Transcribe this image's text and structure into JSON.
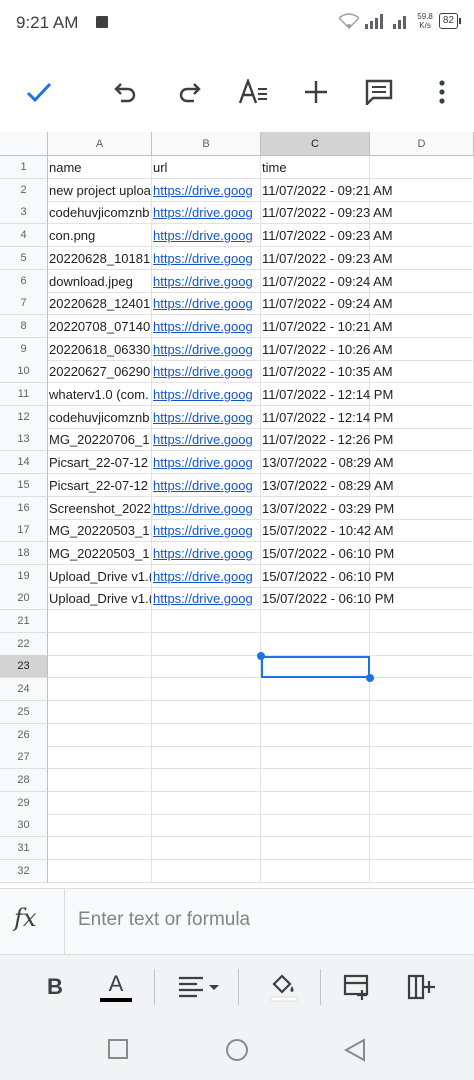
{
  "status_bar": {
    "time": "9:21 AM",
    "speed_value": "59.8",
    "speed_unit": "K/s",
    "battery": "82"
  },
  "toolbar": {
    "icons": [
      "check-icon",
      "undo-icon",
      "redo-icon",
      "text-format-icon",
      "add-icon",
      "comment-icon",
      "more-vert-icon"
    ]
  },
  "sheet": {
    "columns": [
      "A",
      "B",
      "C",
      "D"
    ],
    "selected_column": "C",
    "selected_row": "23",
    "rows": [
      {
        "n": "1",
        "name": "name",
        "url": "url",
        "time": "time"
      },
      {
        "n": "2",
        "name": "new project uploa",
        "url": "https://drive.goog",
        "time": "11/07/2022 - 09:21 AM"
      },
      {
        "n": "3",
        "name": "codehuvjicomznb",
        "url": "https://drive.goog",
        "time": "11/07/2022 - 09:23 AM"
      },
      {
        "n": "4",
        "name": "con.png",
        "url": "https://drive.goog",
        "time": "11/07/2022 - 09:23 AM"
      },
      {
        "n": "5",
        "name": "20220628_10181",
        "url": "https://drive.goog",
        "time": "11/07/2022 - 09:23 AM"
      },
      {
        "n": "6",
        "name": "download.jpeg",
        "url": "https://drive.goog",
        "time": "11/07/2022 - 09:24 AM"
      },
      {
        "n": "7",
        "name": "20220628_12401",
        "url": "https://drive.goog",
        "time": "11/07/2022 - 09:24 AM"
      },
      {
        "n": "8",
        "name": "20220708_07140",
        "url": "https://drive.goog",
        "time": "11/07/2022 - 10:21 AM"
      },
      {
        "n": "9",
        "name": "20220618_06330",
        "url": "https://drive.goog",
        "time": "11/07/2022 - 10:26 AM"
      },
      {
        "n": "10",
        "name": "20220627_06290",
        "url": "https://drive.goog",
        "time": "11/07/2022 - 10:35 AM"
      },
      {
        "n": "11",
        "name": "whaterv1.0 (com.",
        "url": "https://drive.goog",
        "time": "11/07/2022 - 12:14 PM"
      },
      {
        "n": "12",
        "name": "codehuvjicomznb",
        "url": "https://drive.goog",
        "time": "11/07/2022 - 12:14 PM"
      },
      {
        "n": "13",
        "name": "MG_20220706_1",
        "url": "https://drive.goog",
        "time": "11/07/2022 - 12:26 PM"
      },
      {
        "n": "14",
        "name": "Picsart_22-07-12",
        "url": "https://drive.goog",
        "time": "13/07/2022 - 08:29 AM"
      },
      {
        "n": "15",
        "name": "Picsart_22-07-12",
        "url": "https://drive.goog",
        "time": "13/07/2022 - 08:29 AM"
      },
      {
        "n": "16",
        "name": "Screenshot_2022",
        "url": "https://drive.goog",
        "time": "13/07/2022 - 03:29 PM"
      },
      {
        "n": "17",
        "name": "MG_20220503_1",
        "url": "https://drive.goog",
        "time": "15/07/2022 - 10:42 AM"
      },
      {
        "n": "18",
        "name": "MG_20220503_1",
        "url": "https://drive.goog",
        "time": "15/07/2022 - 06:10 PM"
      },
      {
        "n": "19",
        "name": "Upload_Drive v1.(",
        "url": "https://drive.goog",
        "time": "15/07/2022 - 06:10 PM"
      },
      {
        "n": "20",
        "name": "Upload_Drive v1.(",
        "url": "https://drive.goog",
        "time": "15/07/2022 - 06:10 PM"
      },
      {
        "n": "21",
        "name": "",
        "url": "",
        "time": ""
      },
      {
        "n": "22",
        "name": "",
        "url": "",
        "time": ""
      },
      {
        "n": "23",
        "name": "",
        "url": "",
        "time": ""
      },
      {
        "n": "24",
        "name": "",
        "url": "",
        "time": ""
      },
      {
        "n": "25",
        "name": "",
        "url": "",
        "time": ""
      },
      {
        "n": "26",
        "name": "",
        "url": "",
        "time": ""
      },
      {
        "n": "27",
        "name": "",
        "url": "",
        "time": ""
      },
      {
        "n": "28",
        "name": "",
        "url": "",
        "time": ""
      },
      {
        "n": "29",
        "name": "",
        "url": "",
        "time": ""
      },
      {
        "n": "30",
        "name": "",
        "url": "",
        "time": ""
      },
      {
        "n": "31",
        "name": "",
        "url": "",
        "time": ""
      },
      {
        "n": "32",
        "name": "",
        "url": "",
        "time": ""
      }
    ]
  },
  "formula_bar": {
    "fx_label": "fx",
    "placeholder": "Enter text or formula"
  },
  "format_bar": {
    "bold_label": "B",
    "text_color_label": "A"
  },
  "colors": {
    "accent": "#1a73e8",
    "link": "#1155cc"
  }
}
